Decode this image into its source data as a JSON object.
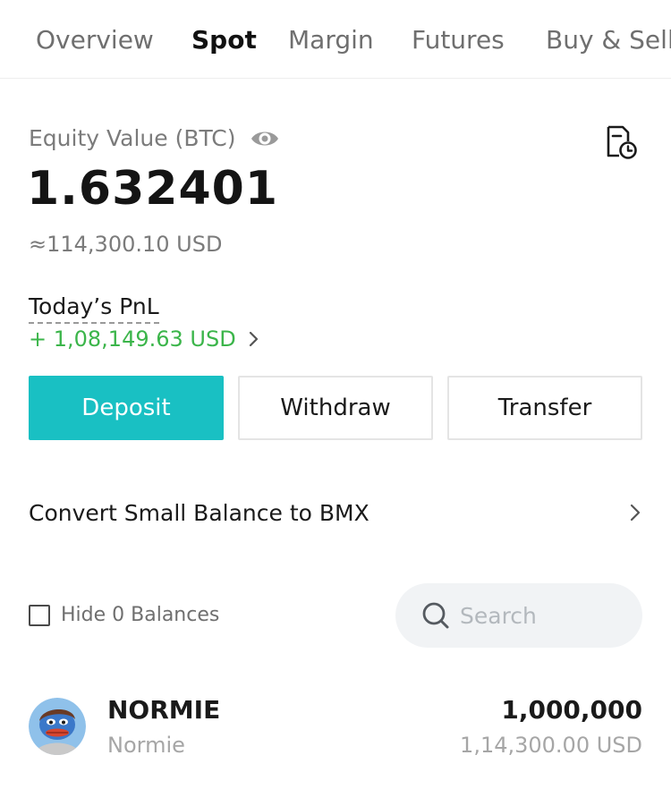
{
  "tabs": [
    {
      "label": "Overview",
      "active": false
    },
    {
      "label": "Spot",
      "active": true
    },
    {
      "label": "Margin",
      "active": false
    },
    {
      "label": "Futures",
      "active": false
    },
    {
      "label": "Buy & Sell",
      "active": false
    }
  ],
  "equity": {
    "label": "Equity Value (BTC)",
    "value": "1.632401",
    "usd": "≈114,300.10 USD"
  },
  "pnl": {
    "label": "Today’s PnL",
    "value": "+ 1,08,149.63 USD"
  },
  "actions": {
    "deposit": "Deposit",
    "withdraw": "Withdraw",
    "transfer": "Transfer"
  },
  "convert": {
    "label": "Convert Small Balance to BMX"
  },
  "filters": {
    "hide_zero_label": "Hide 0 Balances",
    "hide_zero_checked": false,
    "search_placeholder": "Search"
  },
  "assets": [
    {
      "symbol": "NORMIE",
      "name": "Normie",
      "amount": "1,000,000",
      "usd_value": "1,14,300.00 USD"
    }
  ],
  "colors": {
    "accent": "#19c0c3",
    "pnl_positive": "#3bb54a",
    "muted_text": "#7b7b7b"
  },
  "icons": {
    "visibility": "eye-icon",
    "history": "document-clock-icon",
    "search": "search-icon",
    "chevron": "chevron-right-icon"
  }
}
